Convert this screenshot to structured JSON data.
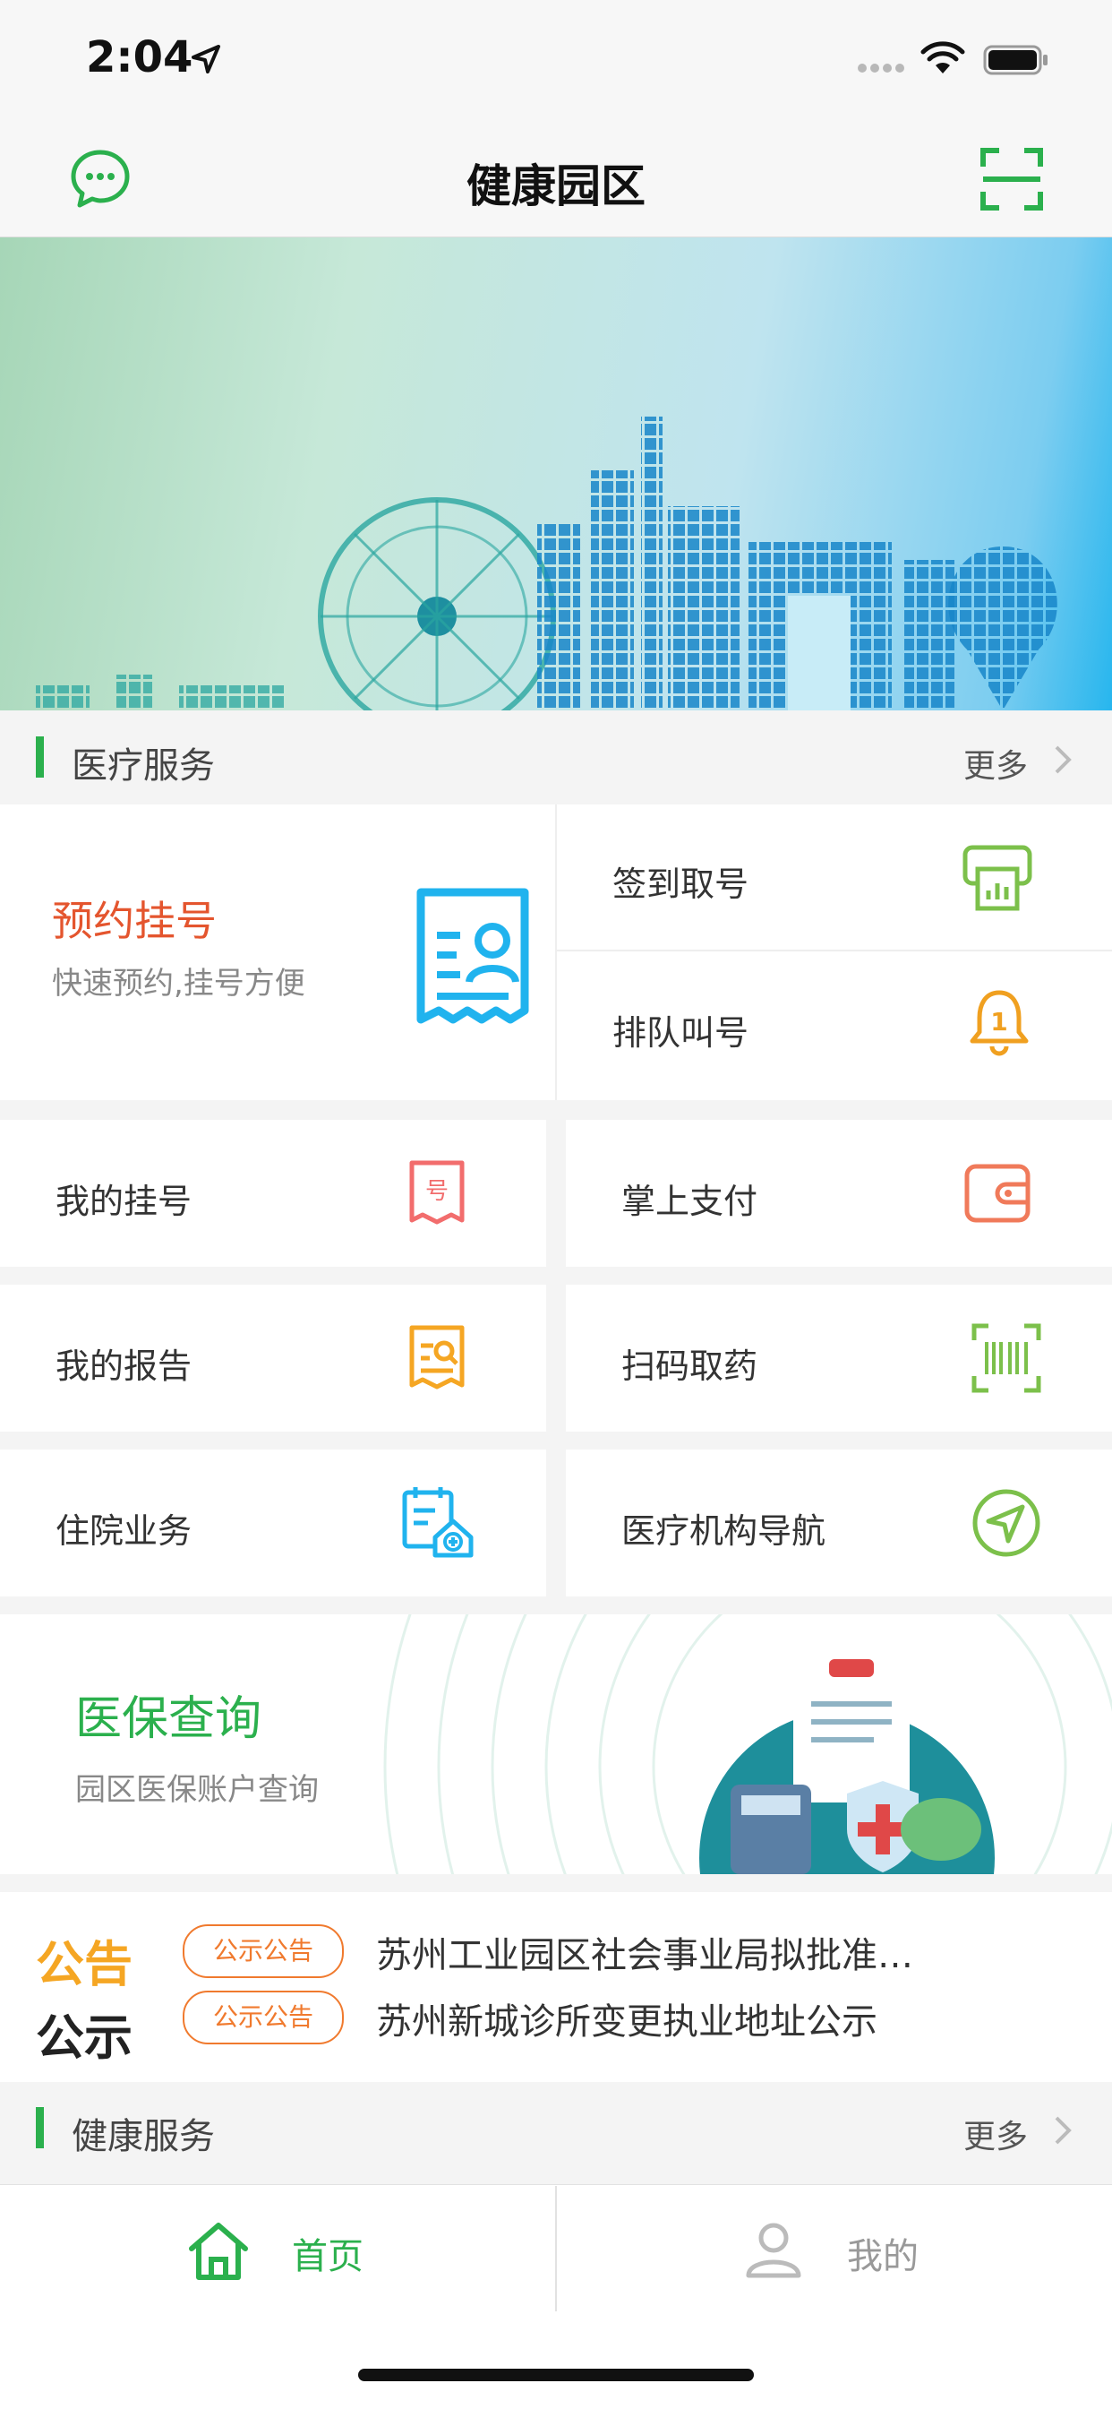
{
  "status_bar": {
    "time": "2:04"
  },
  "header": {
    "title": "健康园区",
    "left_icon": "chat-bubble-icon",
    "right_icon": "scan-icon"
  },
  "colors": {
    "brand_green": "#2bb04d",
    "appointment_red": "#e4552e",
    "notice_orange": "#f07a2e",
    "cyan": "#20b3ee"
  },
  "medical": {
    "title": "医疗服务",
    "more": "更多",
    "appointment": {
      "title": "预约挂号",
      "subtitle": "快速预约,挂号方便"
    },
    "checkin": {
      "label": "签到取号"
    },
    "queue": {
      "label": "排队叫号"
    },
    "grid": [
      {
        "label": "我的挂号",
        "icon": "registration-icon"
      },
      {
        "label": "掌上支付",
        "icon": "wallet-icon"
      },
      {
        "label": "我的报告",
        "icon": "report-icon"
      },
      {
        "label": "扫码取药",
        "icon": "barcode-icon"
      },
      {
        "label": "住院业务",
        "icon": "hospital-icon"
      },
      {
        "label": "医疗机构导航",
        "icon": "navigation-icon"
      }
    ]
  },
  "insurance": {
    "title": "医保查询",
    "subtitle": "园区医保账户查询"
  },
  "notices": {
    "heading_line1": "公告",
    "heading_line2": "公示",
    "items": [
      {
        "tag": "公示公告",
        "text": "苏州工业园区社会事业局拟批准…"
      },
      {
        "tag": "公示公告",
        "text": "苏州新城诊所变更执业地址公示"
      }
    ]
  },
  "health": {
    "title": "健康服务",
    "more": "更多"
  },
  "tabbar": {
    "home": "首页",
    "mine": "我的"
  }
}
